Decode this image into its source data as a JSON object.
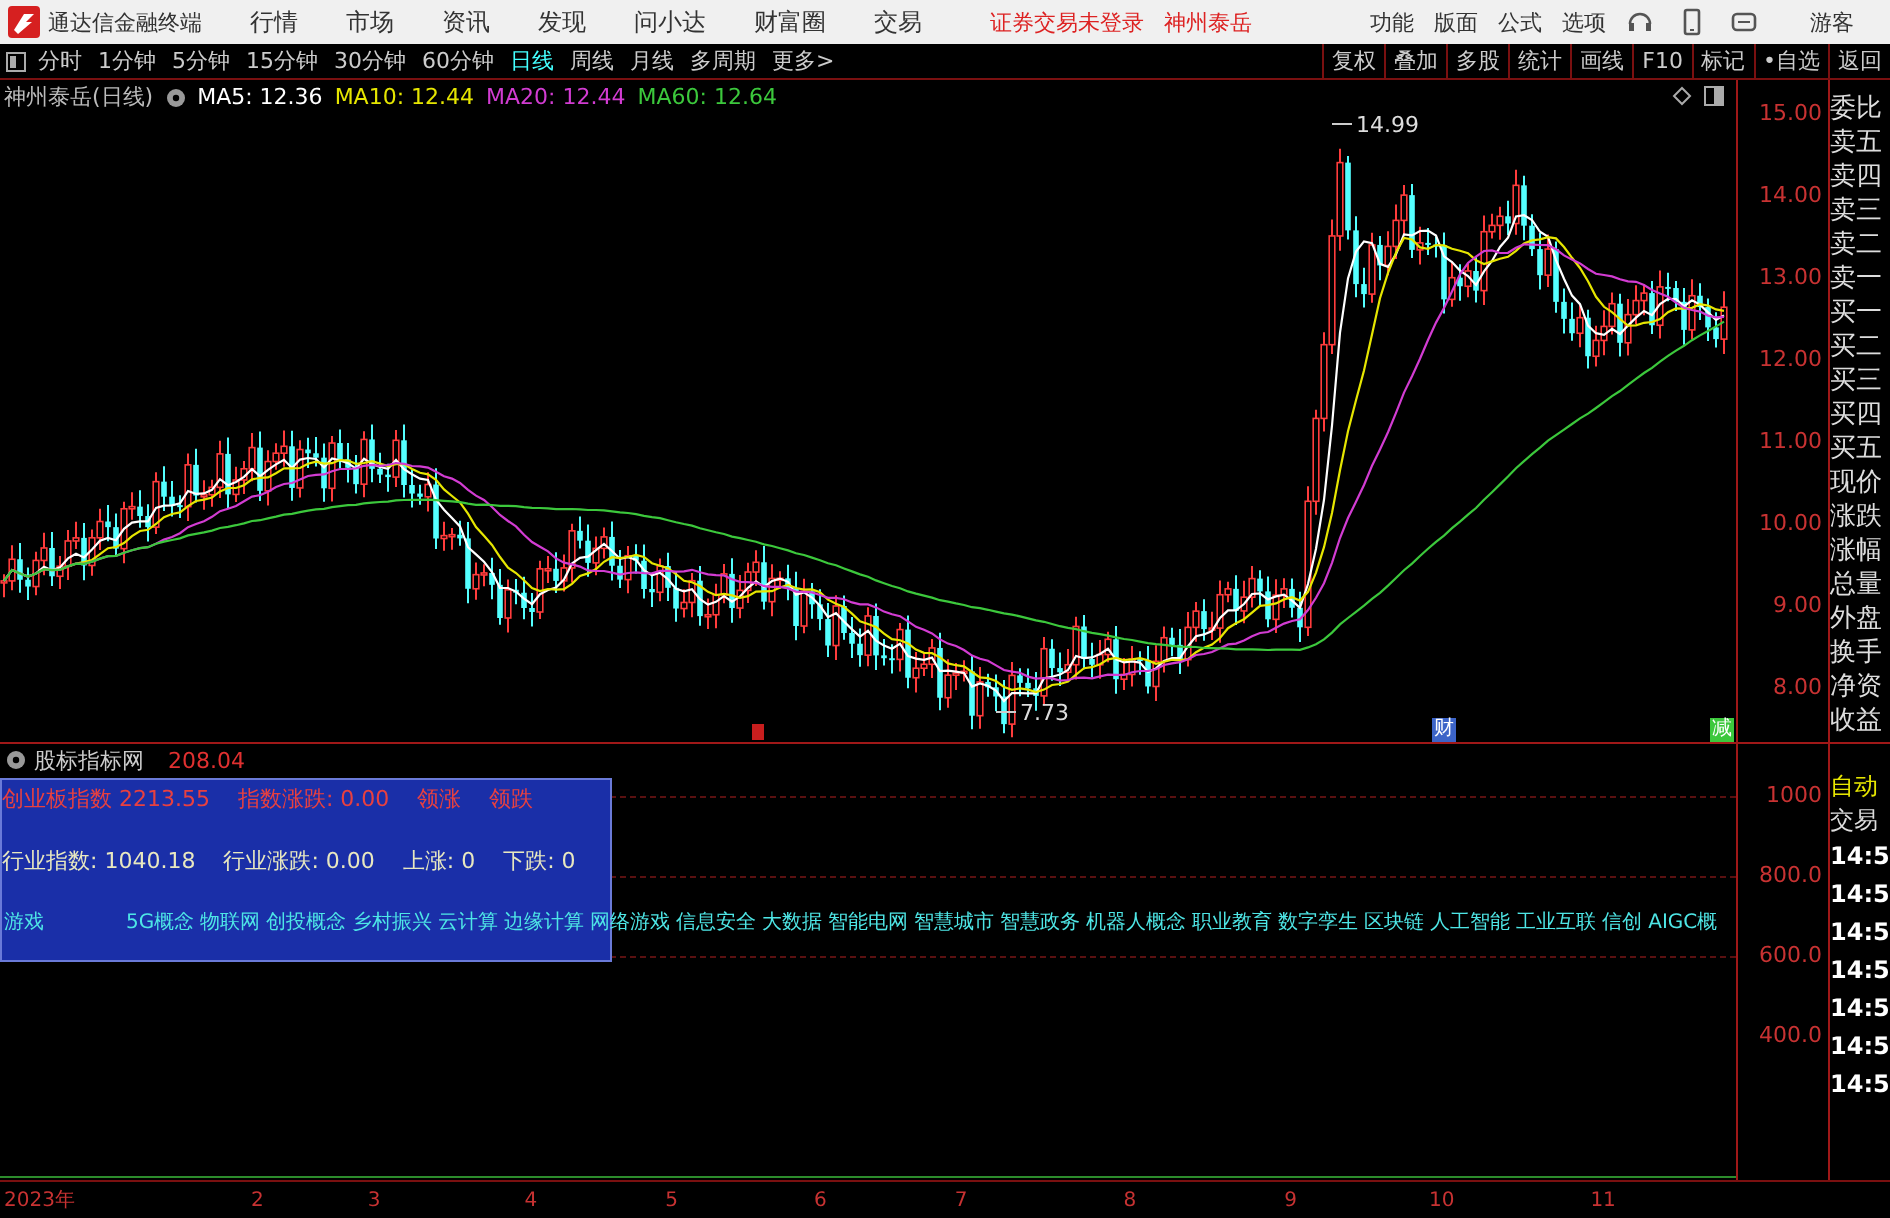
{
  "title_bar": {
    "app_name": "通达信金融终端",
    "menu": [
      "行情",
      "市场",
      "资讯",
      "发现",
      "问小达",
      "财富圈",
      "交易"
    ],
    "login_status": "证券交易未登录",
    "stock_name": "神州泰岳",
    "right_menu": [
      "功能",
      "版面",
      "公式",
      "选项"
    ],
    "user": "游客"
  },
  "period_tabs": [
    {
      "label": "分时",
      "selected": false
    },
    {
      "label": "1分钟",
      "selected": false
    },
    {
      "label": "5分钟",
      "selected": false
    },
    {
      "label": "15分钟",
      "selected": false
    },
    {
      "label": "30分钟",
      "selected": false
    },
    {
      "label": "60分钟",
      "selected": false
    },
    {
      "label": "日线",
      "selected": true
    },
    {
      "label": "周线",
      "selected": false
    },
    {
      "label": "月线",
      "selected": false
    },
    {
      "label": "多周期",
      "selected": false
    },
    {
      "label": "更多>",
      "selected": false
    }
  ],
  "toolbar_buttons": [
    "复权",
    "叠加",
    "多股",
    "统计",
    "画线",
    "F10",
    "标记",
    "•自选",
    "返回"
  ],
  "main_chart": {
    "title": "神州泰岳(日线)",
    "indicators": [
      {
        "label": "MA5: 12.36",
        "color": "#ffffff"
      },
      {
        "label": "MA10: 12.44",
        "color": "#e6e600"
      },
      {
        "label": "MA20: 12.44",
        "color": "#d23cd2"
      },
      {
        "label": "MA60: 12.64",
        "color": "#3cc83c"
      }
    ],
    "high_label": "14.99",
    "low_label": "7.73",
    "price_axis": [
      "15.00",
      "14.00",
      "13.00",
      "12.00",
      "11.00",
      "10.00",
      "9.00",
      "8.00"
    ],
    "event_marks": [
      {
        "label": "财",
        "color": "#3c64c8"
      },
      {
        "label": "减",
        "color": "#3cc83c"
      }
    ]
  },
  "quote_labels": [
    "委比",
    "卖五",
    "卖四",
    "卖三",
    "卖二",
    "卖一",
    "买一",
    "买二",
    "买三",
    "买四",
    "买五",
    "现价",
    "涨跌",
    "涨幅",
    "总量",
    "外盘",
    "换手",
    "净资",
    "收益"
  ],
  "indicator_panel": {
    "title": "股标指标网",
    "value": "208.04",
    "board_row": [
      "创业板指数 2213.55",
      "指数涨跌: 0.00",
      "领涨",
      "领跌"
    ],
    "industry_row": [
      "行业指数: 1040.18",
      "行业涨跌: 0.00",
      "上涨: 0",
      "下跌: 0"
    ],
    "industry": "游戏",
    "concepts": [
      "5G概念",
      "物联网",
      "创投概念",
      "乡村振兴",
      "云计算",
      "边缘计算",
      "网络游戏",
      "信息安全",
      "大数据",
      "智能电网",
      "智慧城市",
      "智慧政务",
      "机器人概念",
      "职业教育",
      "数字孪生",
      "区块链",
      "人工智能",
      "工业互联",
      "信创",
      "AIGC概"
    ],
    "axis": [
      "1000",
      "800.0",
      "600.0",
      "400.0"
    ]
  },
  "trade_panel": {
    "mode": [
      "自动",
      "交易"
    ],
    "times": [
      "14:5",
      "14:5",
      "14:5",
      "14:5",
      "14:5",
      "14:5",
      "14:5"
    ]
  },
  "date_axis": [
    "2023年",
    "2",
    "3",
    "4",
    "5",
    "6",
    "7",
    "8",
    "9",
    "10",
    "11"
  ]
}
